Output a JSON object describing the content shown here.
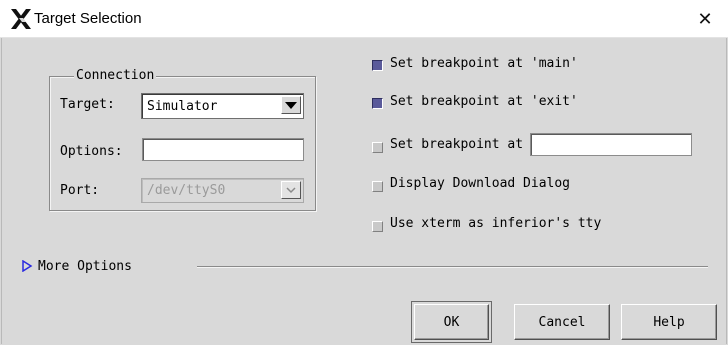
{
  "window": {
    "title": "Target Selection",
    "close_symbol": "✕"
  },
  "connection": {
    "group_title": "Connection",
    "target": {
      "label": "Target:",
      "value": "Simulator"
    },
    "options": {
      "label": "Options:",
      "value": ""
    },
    "port": {
      "label": "Port:",
      "value": "/dev/ttyS0",
      "enabled": false
    }
  },
  "checkboxes": [
    {
      "label": "Set breakpoint at 'main'",
      "checked": true
    },
    {
      "label": "Set breakpoint at 'exit'",
      "checked": true
    },
    {
      "label": "Set breakpoint at",
      "checked": false,
      "value": ""
    },
    {
      "label": "Display Download Dialog",
      "checked": false
    },
    {
      "label": "Use xterm as inferior's tty",
      "checked": false
    }
  ],
  "more_options": {
    "label": "More Options",
    "icon": "triangle-right-icon",
    "color": "#2a2ae0"
  },
  "buttons": {
    "ok": "OK",
    "cancel": "Cancel",
    "help": "Help"
  },
  "colors": {
    "checked": "#5a5a9a",
    "background": "#d9d9d9"
  }
}
